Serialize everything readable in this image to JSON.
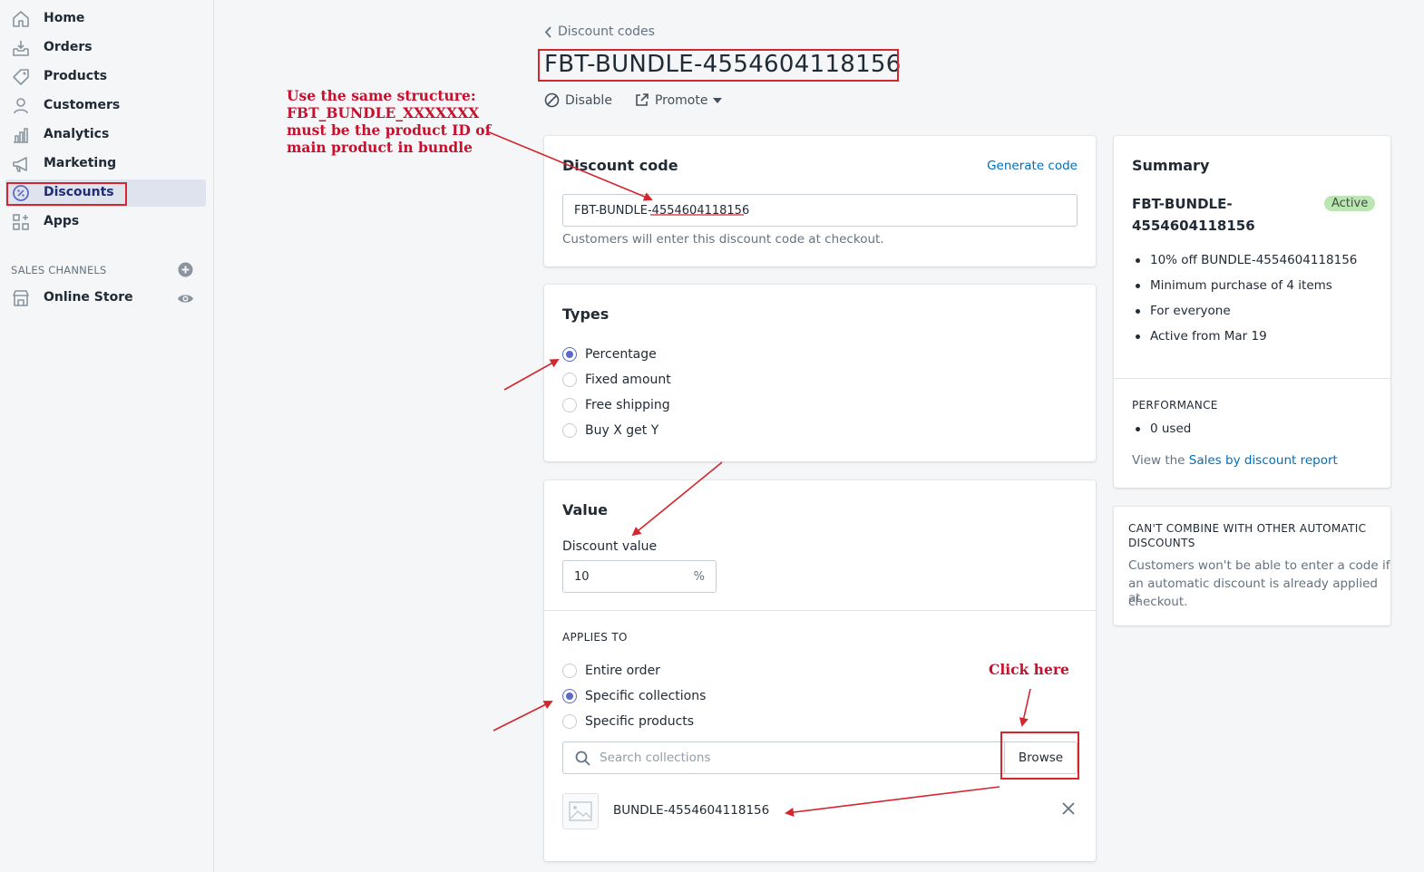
{
  "sidebar": {
    "items": [
      {
        "label": "Home",
        "icon": "home-icon"
      },
      {
        "label": "Orders",
        "icon": "orders-icon"
      },
      {
        "label": "Products",
        "icon": "tag-icon"
      },
      {
        "label": "Customers",
        "icon": "person-icon"
      },
      {
        "label": "Analytics",
        "icon": "bar-chart-icon"
      },
      {
        "label": "Marketing",
        "icon": "megaphone-icon"
      },
      {
        "label": "Discounts",
        "icon": "discount-icon",
        "active": true
      },
      {
        "label": "Apps",
        "icon": "apps-icon"
      }
    ],
    "sales_channels_heading": "SALES CHANNELS",
    "online_store_label": "Online Store"
  },
  "header": {
    "back_label": "Discount codes",
    "title": "FBT-BUNDLE-4554604118156",
    "disable_label": "Disable",
    "promote_label": "Promote"
  },
  "discount_code_card": {
    "title": "Discount code",
    "generate_label": "Generate code",
    "code_value": "FBT-BUNDLE-4554604118156",
    "help_text": "Customers will enter this discount code at checkout."
  },
  "types_card": {
    "title": "Types",
    "options": [
      {
        "label": "Percentage",
        "checked": true
      },
      {
        "label": "Fixed amount",
        "checked": false
      },
      {
        "label": "Free shipping",
        "checked": false
      },
      {
        "label": "Buy X get Y",
        "checked": false
      }
    ]
  },
  "value_card": {
    "title": "Value",
    "discount_value_label": "Discount value",
    "discount_value": "10",
    "suffix": "%",
    "applies_to_heading": "APPLIES TO",
    "applies_options": [
      {
        "label": "Entire order",
        "checked": false
      },
      {
        "label": "Specific collections",
        "checked": true
      },
      {
        "label": "Specific products",
        "checked": false
      }
    ],
    "search_placeholder": "Search collections",
    "browse_label": "Browse",
    "selected_collection": "BUNDLE-4554604118156"
  },
  "summary_card": {
    "title": "Summary",
    "code_line1": "FBT-BUNDLE-",
    "code_line2": "4554604118156",
    "status": "Active",
    "bullets": [
      "10% off BUNDLE-4554604118156",
      "Minimum purchase of 4 items",
      "For everyone",
      "Active from Mar 19"
    ],
    "performance_heading": "PERFORMANCE",
    "performance_bullets": [
      "0 used"
    ],
    "report_prefix": "View the ",
    "report_link": "Sales by discount report"
  },
  "combine_card": {
    "heading_line1": "CAN'T COMBINE WITH OTHER AUTOMATIC",
    "heading_line2": "DISCOUNTS",
    "body_line1": "Customers won't be able to enter a code if",
    "body_line2": "an automatic discount is already applied at",
    "body_line3": "checkout."
  },
  "annotations": {
    "structure_lines": [
      "Use the same structure:",
      "FBT_BUNDLE_XXXXXXX",
      "must be the product ID of",
      "main product in bundle"
    ],
    "click_here": "Click here"
  },
  "colors": {
    "accent": "#5c6ac4",
    "link": "#006fbb",
    "annotation": "#d3262e",
    "badge_bg": "#bbe5b3"
  }
}
